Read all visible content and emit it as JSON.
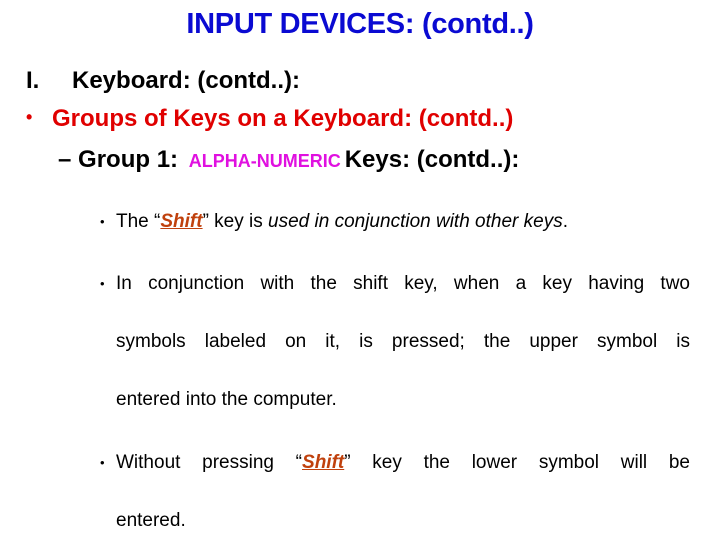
{
  "slide": {
    "title": "INPUT DEVICES: (contd..)",
    "level1": {
      "number": "I.",
      "text": "Keyboard: (contd..):"
    },
    "level2": {
      "bullet": "•",
      "text": "Groups of Keys on a Keyboard: (contd..)"
    },
    "level3": {
      "dash": "–",
      "prefix": "Group 1:",
      "highlight": "ALPHA-NUMERIC",
      "suffix": "Keys: (contd..):"
    },
    "points": [
      {
        "bullet": "•",
        "before": "The “",
        "emphasis": "Shift",
        "middle": "” key is ",
        "italic": "used in conjunction with other keys",
        "after": "."
      },
      {
        "bullet": "•",
        "line1": "In conjunction with the shift key, when a key having two",
        "line2": "symbols labeled on it, is pressed; the upper symbol is",
        "line3": "entered into the computer."
      },
      {
        "bullet": "•",
        "before": "Without pressing “",
        "emphasis": "Shift",
        "after_line1": "” key the lower symbol will be",
        "line2": "entered."
      }
    ],
    "colors": {
      "title": "#0a0ad2",
      "level2": "#e00000",
      "highlight": "#e010e0",
      "emphasis": "#c0410d"
    }
  }
}
